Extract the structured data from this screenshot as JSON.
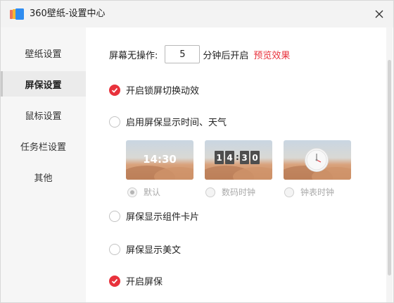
{
  "window": {
    "title": "360壁纸-设置中心"
  },
  "sidebar": {
    "items": [
      {
        "label": "壁纸设置",
        "active": false
      },
      {
        "label": "屏保设置",
        "active": true
      },
      {
        "label": "鼠标设置",
        "active": false
      },
      {
        "label": "任务栏设置",
        "active": false
      },
      {
        "label": "其他",
        "active": false
      }
    ]
  },
  "idle": {
    "prefix": "屏幕无操作:",
    "minutes": "5",
    "suffix": "分钟后开启",
    "preview_link": "预览效果"
  },
  "options": {
    "lock_switch_anim": {
      "label": "开启锁屏切换动效",
      "checked": true
    },
    "show_time_weather": {
      "label": "启用屏保显示时间、天气",
      "checked": false
    },
    "show_widget_cards": {
      "label": "屏保显示组件卡片",
      "checked": false
    },
    "show_prose": {
      "label": "屏保显示美文",
      "checked": false
    },
    "enable_screensaver": {
      "label": "开启屏保",
      "checked": true
    }
  },
  "clock_styles": [
    {
      "label": "默认",
      "preview_text": "14:30",
      "selected": true
    },
    {
      "label": "数码时钟",
      "digits": [
        "1",
        "4",
        "3",
        "0"
      ],
      "selected": false
    },
    {
      "label": "钟表时钟",
      "selected": false
    }
  ],
  "colors": {
    "accent": "#e8323c",
    "sidebar_bg": "#f6f6f6",
    "titlebar_bg": "#f3f3f3"
  }
}
